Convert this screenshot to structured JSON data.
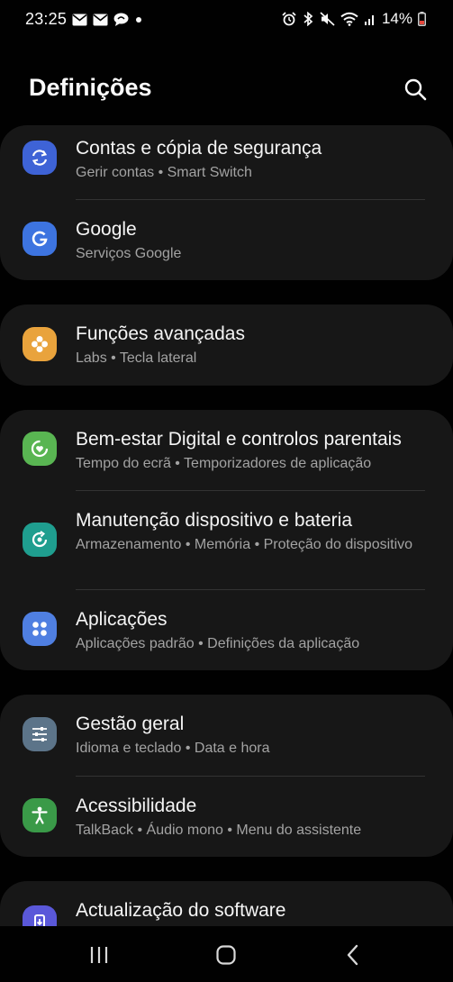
{
  "status_bar": {
    "time": "23:25",
    "battery_text": "14%",
    "left_icons": [
      "mail-icon",
      "mail-icon",
      "chat-bubble-icon",
      "dot-icon"
    ],
    "right_icons": [
      "alarm-icon",
      "bluetooth-icon",
      "mute-icon",
      "wifi-icon",
      "signal-icon",
      "battery-low-icon"
    ]
  },
  "header": {
    "title": "Definições"
  },
  "cards": [
    {
      "items": [
        {
          "title": "Contas e cópia de segurança",
          "subtitle": "Gerir contas  •  Smart Switch",
          "icon": "sync-icon",
          "icon_color": "#3e63d6"
        },
        {
          "title": "Google",
          "subtitle": "Serviços Google",
          "icon": "google-icon",
          "icon_color": "#3d74e0"
        }
      ]
    },
    {
      "items": [
        {
          "title": "Funções avançadas",
          "subtitle": "Labs  •  Tecla lateral",
          "icon": "puzzle-gear-icon",
          "icon_color": "#e9a33c"
        }
      ]
    },
    {
      "items": [
        {
          "title": "Bem-estar Digital e controlos parentais",
          "subtitle": "Tempo do ecrã  •  Temporizadores de aplicação",
          "icon": "heart-circle-icon",
          "icon_color": "#59b552"
        },
        {
          "title": "Manutenção dispositivo e bateria",
          "subtitle": "Armazenamento  •  Memória  •  Proteção do dispositivo",
          "icon": "refresh-circle-icon",
          "icon_color": "#1f9e8f"
        },
        {
          "title": "Aplicações",
          "subtitle": "Aplicações padrão  •  Definições da aplicação",
          "icon": "apps-grid-icon",
          "icon_color": "#4f7fe1"
        }
      ]
    },
    {
      "items": [
        {
          "title": "Gestão geral",
          "subtitle": "Idioma e teclado  •  Data e hora",
          "icon": "sliders-icon",
          "icon_color": "#5c7489"
        },
        {
          "title": "Acessibilidade",
          "subtitle": "TalkBack  •  Áudio mono  •  Menu do assistente",
          "icon": "accessibility-icon",
          "icon_color": "#3a9a48"
        }
      ]
    },
    {
      "items": [
        {
          "title": "Actualização do software",
          "icon": "software-update-icon",
          "icon_color": "#5a58d9"
        }
      ]
    }
  ],
  "nav_bar": {
    "buttons": [
      "recent-apps-icon",
      "home-icon",
      "back-icon"
    ]
  }
}
